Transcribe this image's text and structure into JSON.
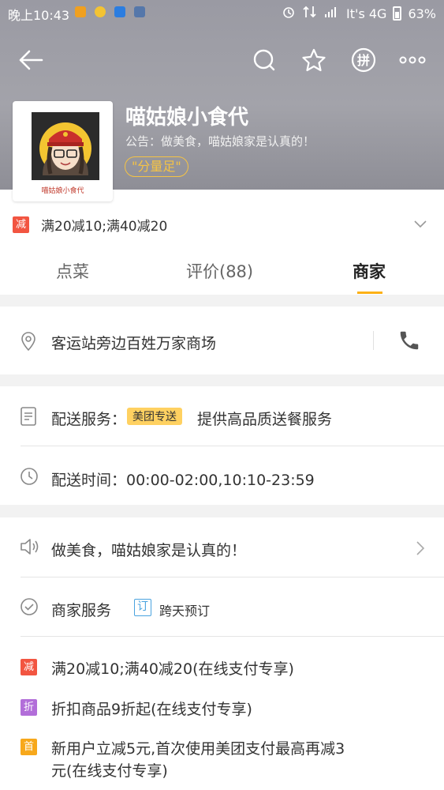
{
  "status_bar": {
    "time": "晚上10:43",
    "carrier": "It's 4G",
    "battery": "63%"
  },
  "shop": {
    "name": "喵姑娘小食代",
    "notice": "公告：做美食，喵姑娘家是认真的！",
    "tag": "\"分量足\"",
    "logo_caption": "喵姑娘小食代"
  },
  "promo": {
    "badge": "减",
    "text": "满20减10;满40减20"
  },
  "tabs": [
    {
      "label": "点菜"
    },
    {
      "label": "评价(88)"
    },
    {
      "label": "商家"
    }
  ],
  "address": {
    "text": "客运站旁边百姓万家商场"
  },
  "delivery": {
    "service_label": "配送服务：",
    "service_tag": "美团专送",
    "service_desc": "提供高品质送餐服务",
    "time_text": "配送时间：00:00-02:00,10:10-23:59"
  },
  "announcement": {
    "text": "做美食，喵姑娘家是认真的！"
  },
  "merchant_service": {
    "label": "商家服务",
    "tag": "订",
    "tag_text": "跨天预订"
  },
  "offers": [
    {
      "badge": "减",
      "color": "#f25541",
      "text": "满20减10;满40减20(在线支付专享)"
    },
    {
      "badge": "折",
      "color": "#b26ed9",
      "text": "折扣商品9折起(在线支付专享)"
    },
    {
      "badge": "首",
      "color": "#f7a81b",
      "text_line1": "新用户立减5元,首次使用美团支付最高再减3",
      "text_line2": "元(在线支付专享)"
    }
  ],
  "colors": {
    "accent": "#fcb116",
    "tag_yellow": "#f5c344",
    "reserve_blue": "#4aa3df"
  }
}
